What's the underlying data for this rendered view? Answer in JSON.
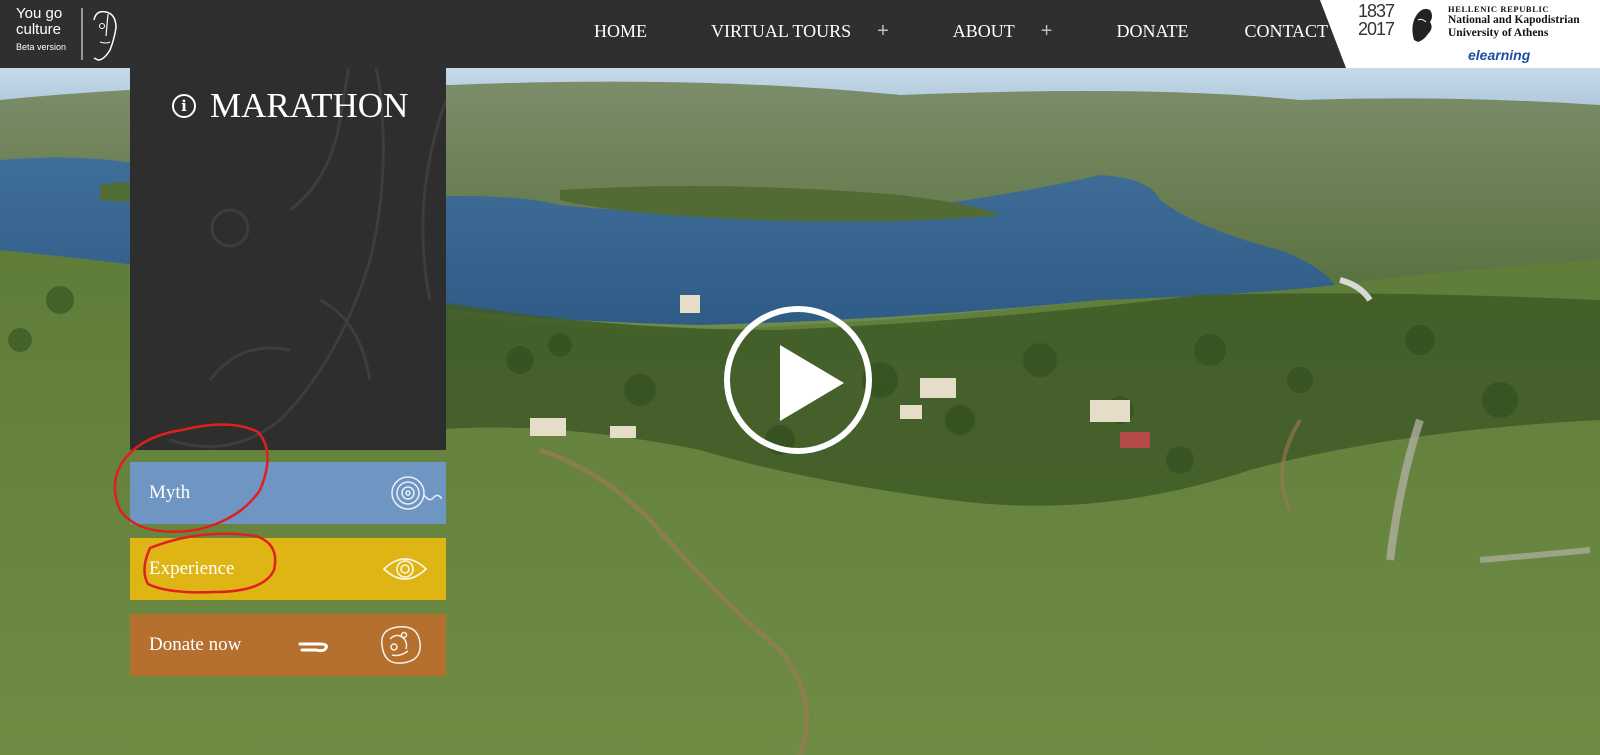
{
  "brand": {
    "line1": "You go",
    "line2": "culture",
    "beta": "Beta version"
  },
  "nav": {
    "items": [
      {
        "label": "HOME",
        "has_submenu": false
      },
      {
        "label": "VIRTUAL TOURS",
        "has_submenu": true
      },
      {
        "label": "ABOUT",
        "has_submenu": true
      },
      {
        "label": "DONATE",
        "has_submenu": false
      },
      {
        "label": "CONTACT",
        "has_submenu": false
      }
    ],
    "submenu_icon": "+"
  },
  "university": {
    "years_top": "1837",
    "years_bottom": "2017",
    "republic": "HELLENIC REPUBLIC",
    "name_line1": "National and Kapodistrian",
    "name_line2": "University of Athens",
    "elearning": "elearning"
  },
  "panel": {
    "title": "MARATHON",
    "info_icon": "info-icon"
  },
  "cards": [
    {
      "label": "Myth",
      "color": "#6f95c2",
      "icon": "spiral-icon"
    },
    {
      "label": "Experience",
      "color": "#dfb415",
      "icon": "eye-icon"
    },
    {
      "label": "Donate now",
      "color": "#b5702f",
      "icon": "donate-hand-icon"
    }
  ],
  "video": {
    "play_icon": "play-icon"
  },
  "colors": {
    "topbar": "#2f2f2f",
    "panel": "#2e2e2e",
    "annotation": "#e0201c"
  }
}
